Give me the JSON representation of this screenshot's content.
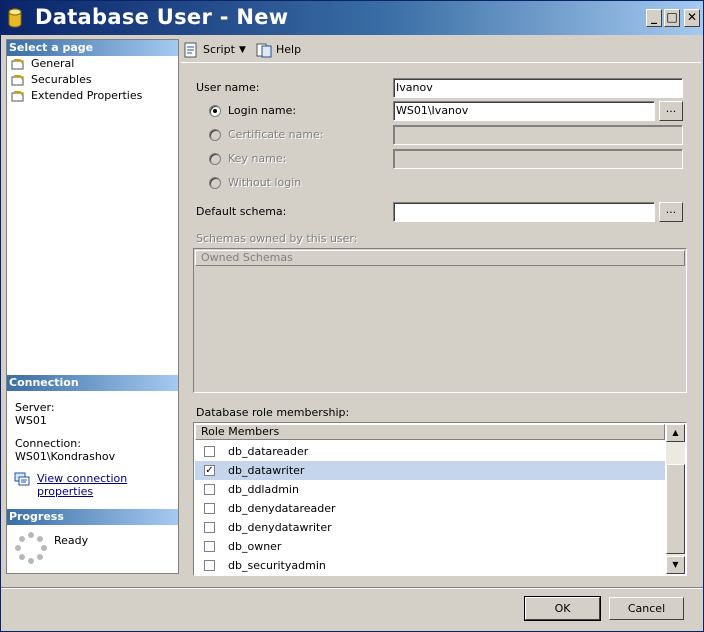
{
  "window": {
    "title": "Database User - New",
    "controls": {
      "minimize": "_",
      "maximize": "□",
      "close": "✕"
    }
  },
  "left_panel": {
    "select_page_header": "Select a page",
    "pages": [
      {
        "label": "General",
        "icon": "page-icon"
      },
      {
        "label": "Securables",
        "icon": "page-icon"
      },
      {
        "label": "Extended Properties",
        "icon": "page-icon"
      }
    ],
    "connection_header": "Connection",
    "server_label": "Server:",
    "server_value": "WS01",
    "connection_label": "Connection:",
    "connection_value": "WS01\\Kondrashov",
    "view_connection_link": "View connection properties",
    "progress_header": "Progress",
    "progress_status": "Ready"
  },
  "toolbar": {
    "script_label": "Script",
    "help_label": "Help"
  },
  "form": {
    "user_name_label": "User name:",
    "user_name_value": "Ivanov",
    "login_name_label": "Login name:",
    "login_name_value": "WS01\\Ivanov",
    "certificate_name_label": "Certificate name:",
    "key_name_label": "Key name:",
    "without_login_label": "Without login",
    "default_schema_label": "Default schema:",
    "default_schema_value": "",
    "browse_label": "...",
    "schemas_owned_label": "Schemas owned by this user:",
    "schemas_column_header": "Owned Schemas",
    "role_membership_label": "Database role membership:",
    "role_column_header": "Role Members",
    "roles": [
      {
        "name": "db_datareader",
        "checked": false
      },
      {
        "name": "db_datawriter",
        "checked": true
      },
      {
        "name": "db_ddladmin",
        "checked": false
      },
      {
        "name": "db_denydatareader",
        "checked": false
      },
      {
        "name": "db_denydatawriter",
        "checked": false
      },
      {
        "name": "db_owner",
        "checked": false
      },
      {
        "name": "db_securityadmin",
        "checked": false
      }
    ]
  },
  "buttons": {
    "ok_label": "OK",
    "cancel_label": "Cancel"
  }
}
